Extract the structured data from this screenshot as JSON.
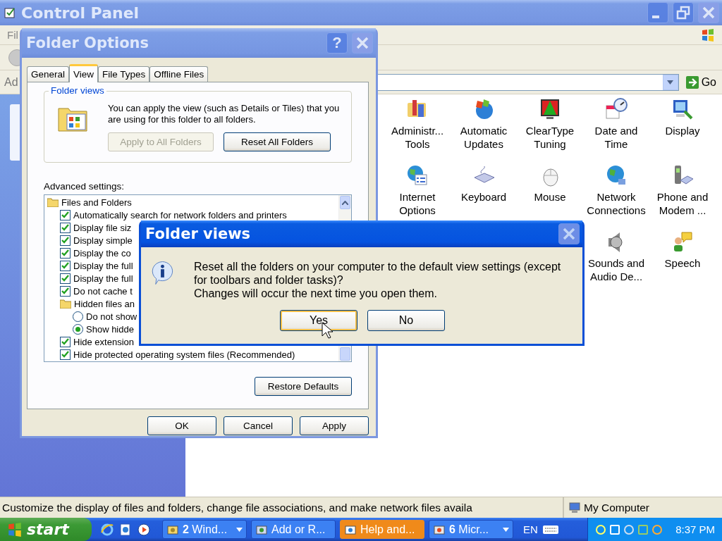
{
  "control_panel": {
    "title": "Control Panel",
    "active": false,
    "menu_label": "Fil",
    "address_label": "Ad",
    "go_label": "Go",
    "icon_rows": [
      [
        {
          "lines": [
            "Administr...",
            "Tools"
          ]
        },
        {
          "lines": [
            "Automatic",
            "Updates"
          ]
        },
        {
          "lines": [
            "ClearType",
            "Tuning"
          ]
        },
        {
          "lines": [
            "Date and",
            "Time"
          ]
        },
        {
          "lines": [
            "Display"
          ]
        }
      ],
      [
        {
          "lines": [
            "Internet",
            "Options"
          ]
        },
        {
          "lines": [
            "Keyboard"
          ]
        },
        {
          "lines": [
            "Mouse"
          ]
        },
        {
          "lines": [
            "Network",
            "Connections"
          ]
        },
        {
          "lines": [
            "Phone and",
            "Modem ..."
          ]
        }
      ],
      [
        {
          "lines": [
            "Sounds and",
            "Audio De..."
          ]
        },
        {
          "lines": [
            "Speech"
          ]
        }
      ]
    ],
    "status_text": "Customize the display of files and folders, change file associations, and make network files availa",
    "status_location": "My Computer"
  },
  "folder_options": {
    "title": "Folder Options",
    "active": false,
    "help_label": "?",
    "tabs": [
      {
        "label": "General",
        "selected": false
      },
      {
        "label": "View",
        "selected": true
      },
      {
        "label": "File Types",
        "selected": false
      },
      {
        "label": "Offline Files",
        "selected": false
      }
    ],
    "group_title": "Folder views",
    "group_text": "You can apply the view (such as Details or Tiles) that you are using for this folder to all folders.",
    "group_buttons": [
      {
        "label": "Apply to All Folders",
        "disabled": true
      },
      {
        "label": "Reset All Folders",
        "disabled": false
      }
    ],
    "advanced_label": "Advanced settings:",
    "settings": [
      {
        "kind": "folder",
        "label": "Files and Folders",
        "children": [
          {
            "kind": "checkbox",
            "label": "Automatically search for network folders and printers",
            "checked": true
          },
          {
            "kind": "checkbox",
            "label": "Display file siz",
            "checked": true
          },
          {
            "kind": "checkbox",
            "label": "Display simple",
            "checked": true
          },
          {
            "kind": "checkbox",
            "label": "Display the co",
            "checked": true
          },
          {
            "kind": "checkbox",
            "label": "Display the full",
            "checked": true
          },
          {
            "kind": "checkbox",
            "label": "Display the full",
            "checked": true
          },
          {
            "kind": "checkbox",
            "label": "Do not cache t",
            "checked": true
          },
          {
            "kind": "folder",
            "label": "Hidden files an",
            "children": [
              {
                "kind": "radio",
                "label": "Do not show",
                "selected": false
              },
              {
                "kind": "radio",
                "label": "Show hidde",
                "selected": true
              }
            ]
          },
          {
            "kind": "checkbox",
            "label": "Hide extension",
            "checked": true
          },
          {
            "kind": "checkbox",
            "label": "Hide protected operating system files (Recommended)",
            "checked": true
          }
        ]
      }
    ],
    "restore_label": "Restore Defaults",
    "buttons": [
      {
        "label": "OK"
      },
      {
        "label": "Cancel"
      },
      {
        "label": "Apply"
      }
    ]
  },
  "message_box": {
    "title": "Folder views",
    "active": true,
    "close_disabled": true,
    "lines": [
      "Reset all the folders on your computer to the default view settings (except for toolbars and folder tasks)?",
      "Changes will occur the next time you open them."
    ],
    "buttons": [
      {
        "label": "Yes",
        "default": true
      },
      {
        "label": "No",
        "default": false
      }
    ]
  },
  "taskbar": {
    "start_label": "start",
    "tasks": [
      {
        "label": "**2** Wind...",
        "grouped": true,
        "flashing": false
      },
      {
        "label": "Add or R...",
        "grouped": false,
        "flashing": false
      },
      {
        "label": "Help and...",
        "grouped": false,
        "flashing": true
      },
      {
        "label": "**6** Micr...",
        "grouped": true,
        "flashing": false
      }
    ],
    "language": "EN",
    "clock": "8:37 PM"
  }
}
